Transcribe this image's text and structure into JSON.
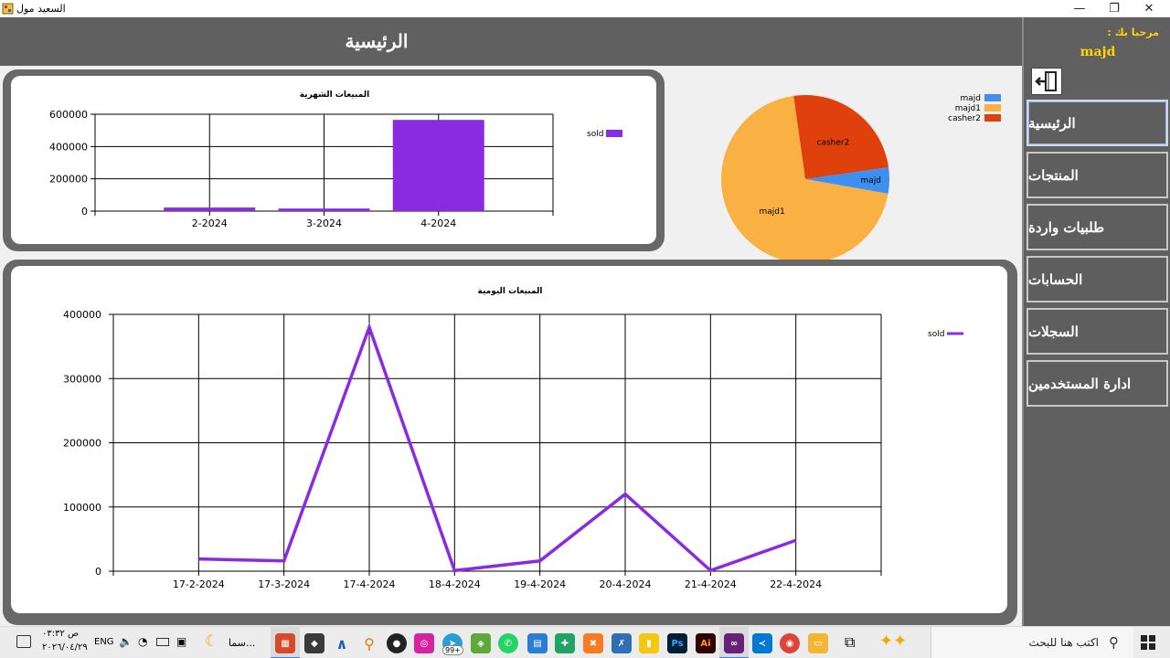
{
  "window": {
    "title": "السعيد مول",
    "minimize_glyph": "—",
    "maximize_glyph": "❐",
    "close_glyph": "✕"
  },
  "header": {
    "title": "الرئيسية"
  },
  "sidebar": {
    "welcome": "مرحبا بك :",
    "username": "majd",
    "logout_icon": "logout-door-icon",
    "items": [
      {
        "label": "الرئيسية",
        "active": true
      },
      {
        "label": "المنتجات",
        "active": false
      },
      {
        "label": "طلبيات واردة",
        "active": false
      },
      {
        "label": "الحسابات",
        "active": false
      },
      {
        "label": "السجلات",
        "active": false
      },
      {
        "label": "ادارة المستخدمين",
        "active": false
      }
    ]
  },
  "charts": {
    "monthly": {
      "type": "bar",
      "title": "المبيعات الشهرية",
      "categories": [
        "2-2024",
        "3-2024",
        "4-2024"
      ],
      "series": [
        {
          "name": "sold",
          "values": [
            22000,
            16000,
            565000
          ],
          "color": "#8a2be2"
        }
      ],
      "ylim": [
        0,
        600000
      ],
      "yticks": [
        0,
        200000,
        400000,
        600000
      ],
      "ytick_labels": [
        "0",
        "200000",
        "400000",
        "600000"
      ],
      "grid": true,
      "legend": "right"
    },
    "pie": {
      "type": "pie",
      "slices": [
        {
          "name": "majd",
          "value": 5,
          "color": "#3d8ff2"
        },
        {
          "name": "majd1",
          "value": 70,
          "color": "#f8b142"
        },
        {
          "name": "casher2",
          "value": 25,
          "color": "#e0400c"
        }
      ],
      "legend": "top-right"
    },
    "daily": {
      "type": "line",
      "title": "المبيعات اليومية",
      "categories": [
        "17-2-2024",
        "17-3-2024",
        "17-4-2024",
        "18-4-2024",
        "19-4-2024",
        "20-4-2024",
        "21-4-2024",
        "22-4-2024"
      ],
      "series": [
        {
          "name": "sold",
          "values": [
            19000,
            16000,
            380000,
            1000,
            16000,
            120000,
            1000,
            48000
          ],
          "color": "#8a2be2"
        }
      ],
      "ylim": [
        0,
        400000
      ],
      "yticks": [
        0,
        100000,
        200000,
        300000,
        400000
      ],
      "ytick_labels": [
        "0",
        "100000",
        "200000",
        "300000",
        "400000"
      ],
      "grid": true,
      "legend": "right"
    }
  },
  "chart_data": [
    {
      "type": "bar",
      "title": "المبيعات الشهرية",
      "categories": [
        "2-2024",
        "3-2024",
        "4-2024"
      ],
      "series": [
        {
          "name": "sold",
          "values": [
            22000,
            16000,
            565000
          ]
        }
      ],
      "ylim": [
        0,
        600000
      ]
    },
    {
      "type": "pie",
      "categories": [
        "majd",
        "majd1",
        "casher2"
      ],
      "values": [
        5,
        70,
        25
      ]
    },
    {
      "type": "line",
      "title": "المبيعات اليومية",
      "categories": [
        "17-2-2024",
        "17-3-2024",
        "17-4-2024",
        "18-4-2024",
        "19-4-2024",
        "20-4-2024",
        "21-4-2024",
        "22-4-2024"
      ],
      "series": [
        {
          "name": "sold",
          "values": [
            19000,
            16000,
            380000,
            1000,
            16000,
            120000,
            1000,
            48000
          ]
        }
      ],
      "ylim": [
        0,
        400000
      ]
    }
  ],
  "taskbar": {
    "time": "۰۳:۳۲ ص",
    "date": "۲۰۲٦/۰٤/۲۹",
    "language": "ENG",
    "search_placeholder": "اكتب هنا للبحث",
    "weather_label": "سما...",
    "notification_badge": "99+",
    "apps": [
      "photoshop-icon",
      "illustrator-icon",
      "visual-studio-icon",
      "vscode-icon",
      "chrome-icon",
      "file-explorer-icon"
    ]
  }
}
